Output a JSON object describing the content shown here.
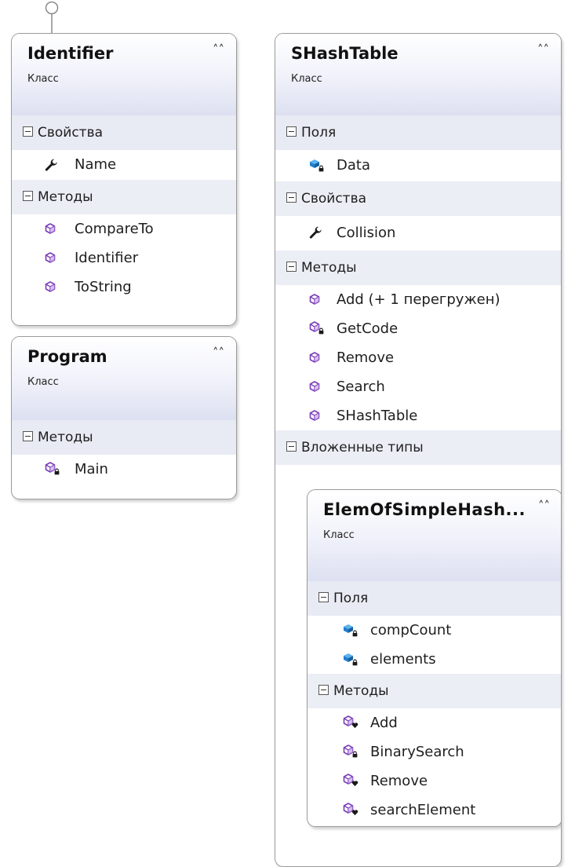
{
  "kind_label": "Класс",
  "identifier": {
    "title": "Identifier",
    "sec_props": "Свойства",
    "props": [
      "Name"
    ],
    "sec_methods": "Методы",
    "methods": [
      "CompareTo",
      "Identifier",
      "ToString"
    ]
  },
  "program": {
    "title": "Program",
    "sec_methods": "Методы",
    "methods": [
      "Main"
    ]
  },
  "shash": {
    "title": "SHashTable",
    "sec_fields": "Поля",
    "fields": [
      "Data"
    ],
    "sec_props": "Свойства",
    "props": [
      "Collision"
    ],
    "sec_methods": "Методы",
    "methods": [
      "Add (+ 1 перегружен)",
      "GetCode",
      "Remove",
      "Search",
      "SHashTable"
    ],
    "sec_nested": "Вложенные типы"
  },
  "elem": {
    "title": "ElemOfSimpleHash...",
    "sec_fields": "Поля",
    "fields": [
      "compCount",
      "elements"
    ],
    "sec_methods": "Методы",
    "methods": [
      "Add",
      "BinarySearch",
      "Remove",
      "searchElement"
    ]
  },
  "icons": {
    "property": "wrench-icon",
    "method_public": "cube-icon",
    "method_private": "cube-lock-icon",
    "method_internal": "cube-heart-icon",
    "field_private": "field-lock-icon"
  },
  "colors": {
    "method": "#7a3db8",
    "field": "#1f7fcf",
    "header_gradient_bottom": "#dde0f1",
    "section_bg": "#eceef6",
    "border": "#9a9a9a"
  }
}
